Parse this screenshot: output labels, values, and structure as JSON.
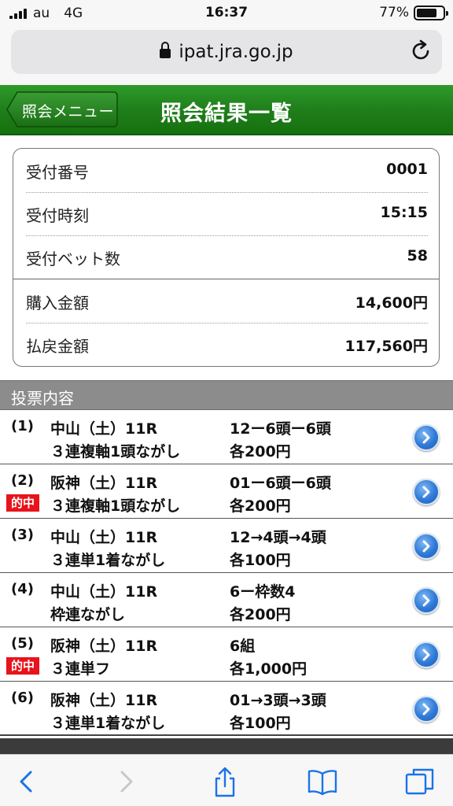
{
  "status": {
    "carrier": "au",
    "network": "4G",
    "time": "16:37",
    "battery": "77%"
  },
  "browser": {
    "url": "ipat.jra.go.jp"
  },
  "header": {
    "back_label": "照会メニュー",
    "title": "照会結果一覧"
  },
  "summary": [
    {
      "label": "受付番号",
      "value": "0001"
    },
    {
      "label": "受付時刻",
      "value": "15:15"
    },
    {
      "label": "受付ベット数",
      "value": "58"
    },
    {
      "label": "購入金額",
      "value": "14,600円"
    },
    {
      "label": "払戻金額",
      "value": "117,560円"
    }
  ],
  "section_title": "投票内容",
  "hit_label": "的中",
  "bets": [
    {
      "no": "(1)",
      "race": "中山（土）11R",
      "type": "３連複軸1頭ながし",
      "combo": "12ー6頭ー6頭",
      "amount": "各200円",
      "hit": false
    },
    {
      "no": "(2)",
      "race": "阪神（土）11R",
      "type": "３連複軸1頭ながし",
      "combo": "01ー6頭ー6頭",
      "amount": "各200円",
      "hit": true
    },
    {
      "no": "(3)",
      "race": "中山（土）11R",
      "type": "３連単1着ながし",
      "combo": "12→4頭→4頭",
      "amount": "各100円",
      "hit": false
    },
    {
      "no": "(4)",
      "race": "中山（土）11R",
      "type": "枠連ながし",
      "combo": "6ー枠数4",
      "amount": "各200円",
      "hit": false
    },
    {
      "no": "(5)",
      "race": "阪神（土）11R",
      "type": "３連単フ",
      "combo": "6組",
      "amount": "各1,000円",
      "hit": true
    },
    {
      "no": "(6)",
      "race": "阪神（土）11R",
      "type": "３連単1着ながし",
      "combo": "01→3頭→3頭",
      "amount": "各100円",
      "hit": false
    }
  ],
  "colors": {
    "header_green": "#1f7f1b",
    "hit_red": "#e8131b",
    "link_blue": "#2f79d6",
    "section_gray": "#8c8c8c"
  },
  "icons": [
    "signal-icon",
    "lock-icon",
    "reload-icon",
    "chevron-right-icon",
    "back-icon",
    "forward-icon",
    "share-icon",
    "bookmarks-icon",
    "tabs-icon"
  ]
}
